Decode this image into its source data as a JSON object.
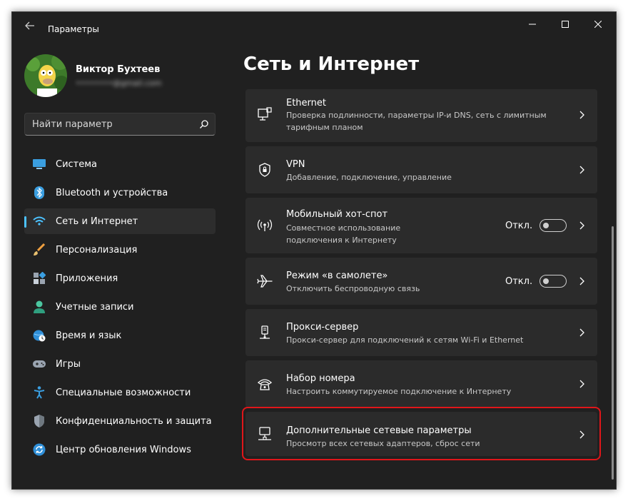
{
  "window": {
    "title": "Параметры",
    "controls": {
      "minimize": "—",
      "maximize": "▢",
      "close": "✕"
    }
  },
  "profile": {
    "name": "Виктор Бухтеев",
    "email": "••••••••@gmail.com"
  },
  "search": {
    "value": "Найти параметр"
  },
  "sidebar": {
    "items": [
      {
        "label": "Система",
        "icon": "display-icon"
      },
      {
        "label": "Bluetooth и устройства",
        "icon": "bluetooth-icon"
      },
      {
        "label": "Сеть и Интернет",
        "icon": "wifi-icon",
        "selected": true
      },
      {
        "label": "Персонализация",
        "icon": "brush-icon"
      },
      {
        "label": "Приложения",
        "icon": "apps-icon"
      },
      {
        "label": "Учетные записи",
        "icon": "person-icon"
      },
      {
        "label": "Время и язык",
        "icon": "globe-clock-icon"
      },
      {
        "label": "Игры",
        "icon": "gamepad-icon"
      },
      {
        "label": "Специальные возможности",
        "icon": "accessibility-icon"
      },
      {
        "label": "Конфиденциальность и защита",
        "icon": "shield-icon"
      },
      {
        "label": "Центр обновления Windows",
        "icon": "update-icon"
      }
    ]
  },
  "main": {
    "title": "Сеть и Интернет",
    "cards": [
      {
        "title": "Ethernet",
        "desc_line1": "Проверка подлинности, параметры IP-и DNS, сеть с лимитным",
        "desc_line2": "тарифным планом",
        "icon": "ethernet-icon"
      },
      {
        "title": "VPN",
        "desc_line1": "Добавление, подключение, управление",
        "icon": "vpn-shield-icon"
      },
      {
        "title": "Мобильный хот-спот",
        "desc_line1": "Совместное использование",
        "desc_line2": "подключения к Интернету",
        "icon": "hotspot-icon",
        "toggle_label": "Откл.",
        "toggle_on": false
      },
      {
        "title": "Режим «в самолете»",
        "desc_line1": "Отключить беспроводную связь",
        "icon": "airplane-icon",
        "toggle_label": "Откл.",
        "toggle_on": false
      },
      {
        "title": "Прокси-сервер",
        "desc_line1": "Прокси-сервер для подключений к сетям Wi-Fi и Ethernet",
        "icon": "proxy-icon"
      },
      {
        "title": "Набор номера",
        "desc_line1": "Настроить коммутируемое подключение к Интернету",
        "icon": "dialup-icon"
      },
      {
        "title": "Дополнительные сетевые параметры",
        "desc_line1": "Просмотр всех сетевых адаптеров, сброс сети",
        "icon": "network-pc-icon",
        "highlighted": true
      }
    ]
  },
  "colors": {
    "background": "#202020",
    "card": "#2b2b2b",
    "accent": "#4cc2ff",
    "highlight": "#e0161a"
  }
}
